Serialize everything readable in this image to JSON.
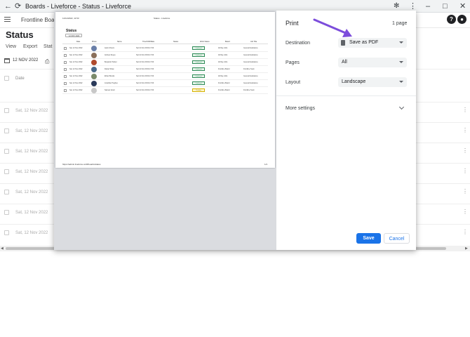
{
  "browser": {
    "title": "Boards - Liveforce - Status - Liveforce"
  },
  "app": {
    "board_name": "Frontline Board",
    "help_label": "?"
  },
  "page": {
    "title": "Status",
    "menu": [
      "View",
      "Export",
      "Stat"
    ],
    "date_filter": "12 NOV 2022",
    "column_date": "Date",
    "rows": [
      "Sat, 12 Nov 2022",
      "Sat, 12 Nov 2022",
      "Sat, 12 Nov 2022",
      "Sat, 12 Nov 2022",
      "Sat, 12 Nov 2022",
      "Sat, 12 Nov 2022",
      "Sat, 12 Nov 2022"
    ]
  },
  "preview": {
    "header_left": "11/11/2022, 11:53",
    "header_center": "Status - Liveforce",
    "doc_title": "Status",
    "filter_chip": "12 NOV 2022",
    "columns": [
      "Date",
      "Photo",
      "Name",
      "Time/Shift/Rate",
      "Status",
      "Work Status",
      "Board",
      "Job Title"
    ],
    "rows": [
      {
        "date": "Sat, 12 Nov 2022",
        "name": "Aaron Peters",
        "shift": "Sat 12 Nov 09:00-17:00",
        "badge": "Confirmed",
        "board": "All Day Jobs",
        "job": "General Assistance",
        "avatar": "#6a7fa8"
      },
      {
        "date": "Sat, 12 Nov 2022",
        "name": "Andrew Reyes",
        "shift": "Sat 12 Nov 09:00-17:00",
        "badge": "Confirmed",
        "board": "All Day Jobs",
        "job": "General Assistance",
        "avatar": "#8a6f5a"
      },
      {
        "date": "Sat, 12 Nov 2022",
        "name": "Benjamin Parker",
        "shift": "Sat 12 Nov 09:00-17:00",
        "badge": "Confirmed",
        "board": "All Day Jobs",
        "job": "General Assistance",
        "avatar": "#b04a2c"
      },
      {
        "date": "Sat, 12 Nov 2022",
        "name": "Daniel Shaw",
        "shift": "Sat 12 Nov 09:00-17:00",
        "badge": "Confirmed",
        "board": "Frontline Board",
        "job": "Frontline Team",
        "avatar": "#4a6a8a"
      },
      {
        "date": "Sat, 12 Nov 2022",
        "name": "Ethan Brooks",
        "shift": "Sat 12 Nov 09:00-17:00",
        "badge": "Confirmed",
        "board": "All Day Jobs",
        "job": "General Assistance",
        "avatar": "#7a8a6a"
      },
      {
        "date": "Sat, 12 Nov 2022",
        "name": "Jonathan Hughes",
        "shift": "Sat 12 Nov 09:00-17:00",
        "badge": "Confirmed",
        "board": "Frontline Board",
        "job": "General Assistance",
        "avatar": "#2a3a5a"
      },
      {
        "date": "Sat, 12 Nov 2022",
        "name": "Samuel Grant",
        "shift": "Sat 12 Nov 09:00-17:00",
        "badge": "Pending",
        "board": "Frontline Board",
        "job": "Frontline Team",
        "avatar": "#c8c8c8"
      }
    ],
    "footer_url": "https://admin.liveforce.co/#/boards/status",
    "footer_page": "1/1"
  },
  "print": {
    "title": "Print",
    "page_count": "1 page",
    "destination_label": "Destination",
    "destination_value": "Save as PDF",
    "pages_label": "Pages",
    "pages_value": "All",
    "layout_label": "Layout",
    "layout_value": "Landscape",
    "more_settings": "More settings",
    "save": "Save",
    "cancel": "Cancel"
  },
  "colors": {
    "accent": "#1a73e8",
    "arrow": "#7c4ddb"
  }
}
